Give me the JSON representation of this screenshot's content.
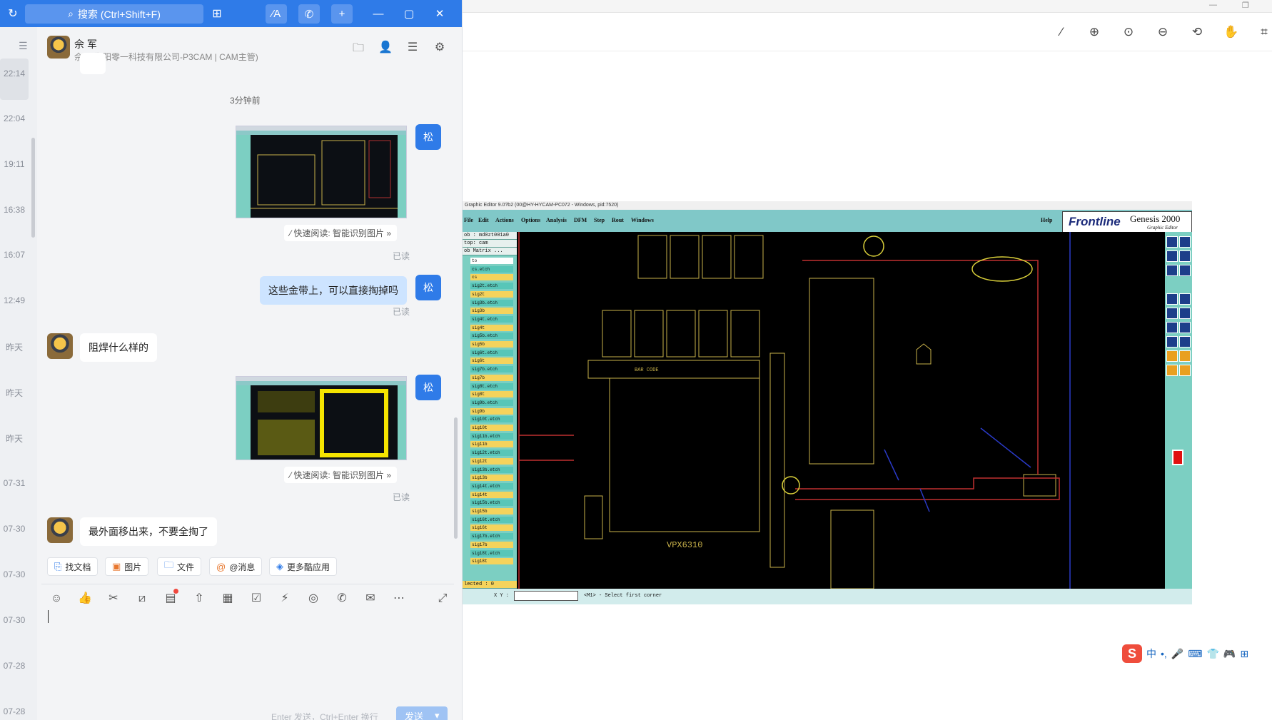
{
  "chat": {
    "search_placeholder": "搜索 (Ctrl+Shift+F)",
    "contact": {
      "name": "佘 军",
      "subtitle": "佘军(衡阳零一科技有限公司-P3CAM | CAM主管)"
    },
    "time_rail": [
      "22:14",
      "22:04",
      "19:11",
      "16:38",
      "16:07",
      "12:49",
      "昨天",
      "昨天",
      "昨天",
      "07-31",
      "07-30",
      "07-30",
      "07-30",
      "07-28",
      "07-28"
    ],
    "time_divider": "3分钟前",
    "me_avatar": "松",
    "messages": {
      "m2_text": "这些金带上，可以直接掏掉吗",
      "m3_text": "阻焊什么样的",
      "m5_text": "最外面移出来，不要全掏了",
      "quick_read": "快速阅读: 智能识别图片 »",
      "read_label": "已读"
    },
    "quick_actions": [
      "找文档",
      "图片",
      "文件",
      "@消息",
      "更多酷应用"
    ],
    "send_hint": "Enter 发送，Ctrl+Enter 换行",
    "send_label": "发送"
  },
  "viewer": {
    "screenshot": {
      "title": "Graphic Editor 9.0?b2 (00@HY-HYCAM-PC072 - Windows, pid:7520)",
      "menus": [
        "File",
        "Edit",
        "Actions",
        "Options",
        "Analysis",
        "DFM",
        "Step",
        "Rout",
        "Windows",
        "Help"
      ],
      "logo_brand": "Frontline",
      "logo_product": "Genesis 2000",
      "logo_sub": "Graphic Editor",
      "job_info": [
        "ob : md0zt001a0",
        "top: cam",
        "ob Matrix ..."
      ],
      "layers": [
        "to",
        "cs.etch",
        "cs",
        "sig2t.etch",
        "sig2t",
        "sig3b.etch",
        "sig3b",
        "sig4t.etch",
        "sig4t",
        "sig5b.etch",
        "sig5b",
        "sig6t.etch",
        "sig6t",
        "sig7b.etch",
        "sig7b",
        "sig8t.etch",
        "sig8t",
        "sig9b.etch",
        "sig9b",
        "sig10t.etch",
        "sig10t",
        "sig11b.etch",
        "sig11b",
        "sig12t.etch",
        "sig12t",
        "sig13b.etch",
        "sig13b",
        "sig14t.etch",
        "sig14t",
        "sig15b.etch",
        "sig15b",
        "sig16t.etch",
        "sig16t",
        "sig17b.etch",
        "sig17b",
        "sig18t.etch",
        "sig18t"
      ],
      "selected": "lected : 0",
      "xy_label": "X Y :",
      "status_msg": "<M1> - Select first corner",
      "board_label": "VPX6310",
      "barcode_label": "BAR CODE"
    }
  }
}
